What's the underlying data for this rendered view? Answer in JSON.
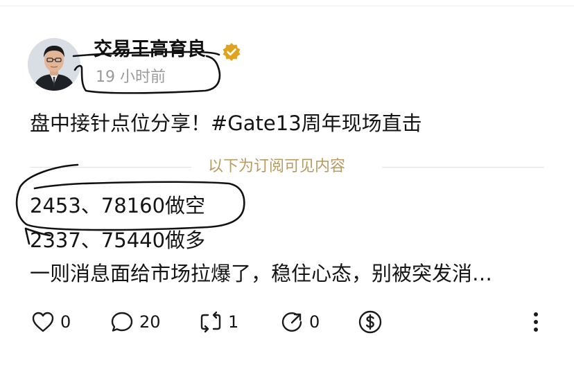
{
  "post": {
    "author_name": "交易王高育良",
    "time": "19 小时前",
    "title": "盘中接针点位分享！#Gate13周年现场直击",
    "subscribe_divider_label": "以下为订阅可见内容",
    "content_lines": [
      "2453、78160做空",
      "2337、75440做多",
      "一则消息面给市场拉爆了，稳住心态，别被突发消…"
    ]
  },
  "actions": {
    "like_count": "0",
    "comment_count": "20",
    "repost_count": "1",
    "quote_count": "0"
  },
  "icons": {
    "verified": "verified-badge-icon",
    "like": "heart-icon",
    "comment": "comment-bubble-icon",
    "repost": "repost-icon",
    "quote": "quote-icon",
    "tip": "dollar-coin-icon",
    "more": "more-vertical-icon"
  },
  "colors": {
    "subscribe_label": "#b89a63",
    "verified_badge": "#e0a31f",
    "muted_text": "#9a9a9a"
  }
}
